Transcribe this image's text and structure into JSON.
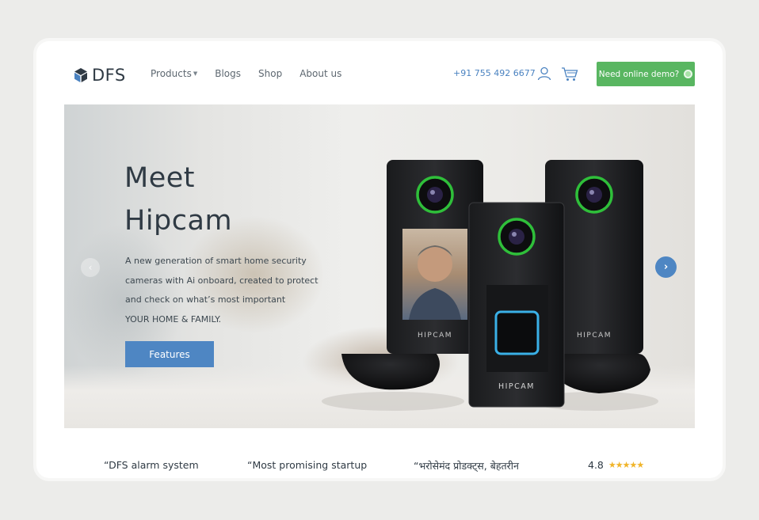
{
  "brand": {
    "name": "DFS"
  },
  "nav": {
    "items": [
      {
        "label": "Products",
        "has_dropdown": true
      },
      {
        "label": "Blogs"
      },
      {
        "label": "Shop"
      },
      {
        "label": "About us"
      }
    ],
    "phone": "+91 755 492 6677",
    "demo_button": "Need online demo?"
  },
  "hero": {
    "title_line1": "Meet",
    "title_line2": "Hipcam",
    "desc_line1": "A new generation of smart home security",
    "desc_line2": "cameras with Ai onboard, created to protect",
    "desc_line3": "and check on what’s most important",
    "desc_line4": "YOUR HOME & FAMILY.",
    "features_button": "Features",
    "device_label": "HIPCAM"
  },
  "testimonials": {
    "quotes": [
      "“DFS alarm system",
      "“Most promising startup",
      "“भरोसेमंद प्रोडक्ट्स, बेहतरीन"
    ],
    "rating_value": "4.8",
    "stars": "★★★★★"
  },
  "colors": {
    "accent_blue": "#4e86c3",
    "demo_green": "#59b661",
    "ring_green": "#2fbf3a",
    "sensor_blue": "#3ab0e6"
  }
}
